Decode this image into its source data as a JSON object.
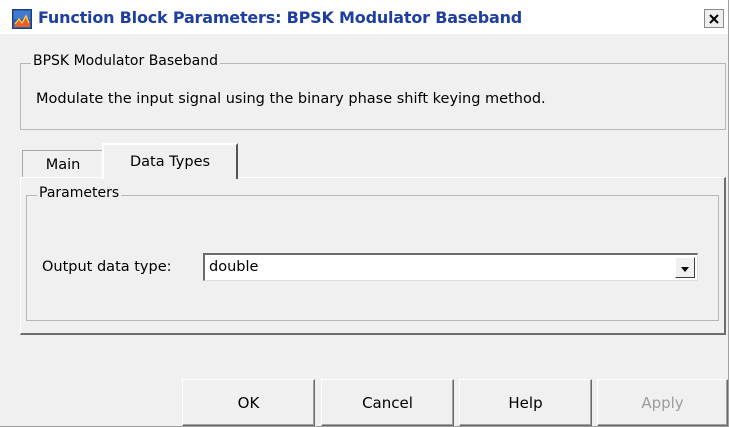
{
  "window": {
    "title": "Function Block Parameters: BPSK Modulator Baseband"
  },
  "block": {
    "group_label": "BPSK Modulator Baseband",
    "description": "Modulate the input signal using the binary phase shift keying method."
  },
  "tabs": [
    {
      "label": "Main",
      "active": false
    },
    {
      "label": "Data Types",
      "active": true
    }
  ],
  "parameters": {
    "group_label": "Parameters",
    "output_data_type": {
      "label": "Output data type:",
      "value": "double"
    }
  },
  "buttons": {
    "ok": "OK",
    "cancel": "Cancel",
    "help": "Help",
    "apply": "Apply"
  },
  "icons": {
    "app": "simulink-block-icon",
    "close": "close-icon",
    "dropdown": "chevron-down-icon"
  },
  "colors": {
    "title_text": "#1e3f9e",
    "dialog_background": "#f0f0f0",
    "disabled_text": "#9c9c9c"
  }
}
